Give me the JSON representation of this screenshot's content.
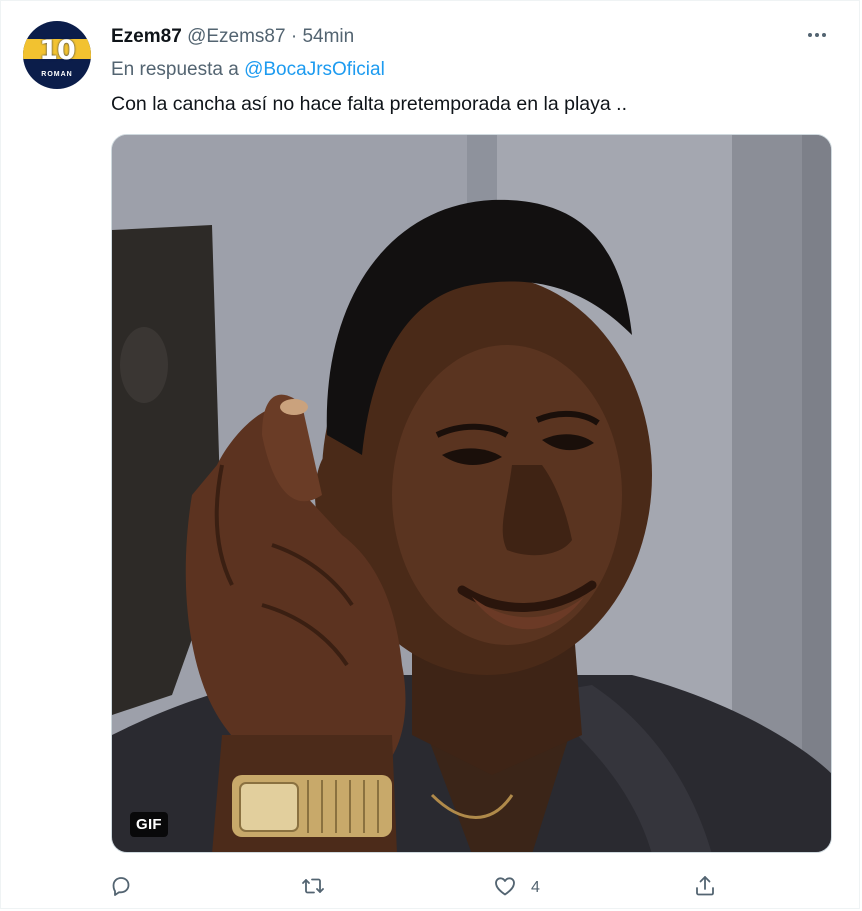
{
  "tweet": {
    "avatar": {
      "number": "10",
      "label": "ROMAN"
    },
    "display_name": "Ezem87",
    "handle": "@Ezems87",
    "separator": "·",
    "time": "54min",
    "reply_prefix": "En respuesta a",
    "reply_to": "@BocaJrsOficial",
    "text": "Con la cancha así no hace falta pretemporada en la playa ..",
    "media": {
      "badge": "GIF"
    },
    "actions": {
      "reply_count": "",
      "retweet_count": "",
      "like_count": "4",
      "share_count": ""
    }
  },
  "colors": {
    "text_primary": "#0f1419",
    "text_secondary": "#536471",
    "accent": "#1d9bf0",
    "border": "#cfd9de"
  },
  "icons": [
    "more-icon",
    "reply-icon",
    "retweet-icon",
    "like-icon",
    "share-icon"
  ]
}
